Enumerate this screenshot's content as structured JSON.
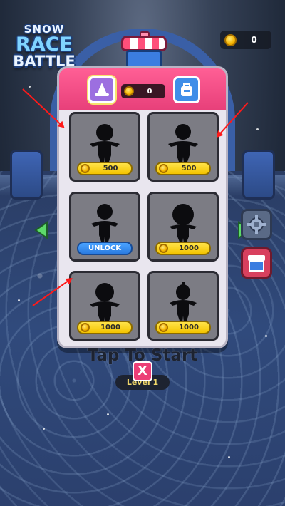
{
  "logo": {
    "line1": "SNOW",
    "line2": "RACE",
    "line3": "BATTLE"
  },
  "top_bar": {
    "coin_count": "0"
  },
  "shop": {
    "coin_count": "0",
    "tabs": [
      {
        "icon": "wizard-hat-icon",
        "active": true
      },
      {
        "icon": "backpack-icon",
        "active": false
      }
    ],
    "items": [
      {
        "kind": "price",
        "label": "500"
      },
      {
        "kind": "price",
        "label": "500"
      },
      {
        "kind": "unlock",
        "label": "UNLOCK"
      },
      {
        "kind": "price",
        "label": "1000"
      },
      {
        "kind": "price",
        "label": "1000"
      },
      {
        "kind": "price",
        "label": "1000"
      }
    ]
  },
  "start": {
    "tap_text": "Tap To Start",
    "level_label": "Level 1",
    "close_label": "X"
  },
  "colors": {
    "panel_header": "#ff5f95",
    "price_button": "#f4c400",
    "unlock_button": "#2b7be0",
    "close_button": "#ec3f77"
  }
}
